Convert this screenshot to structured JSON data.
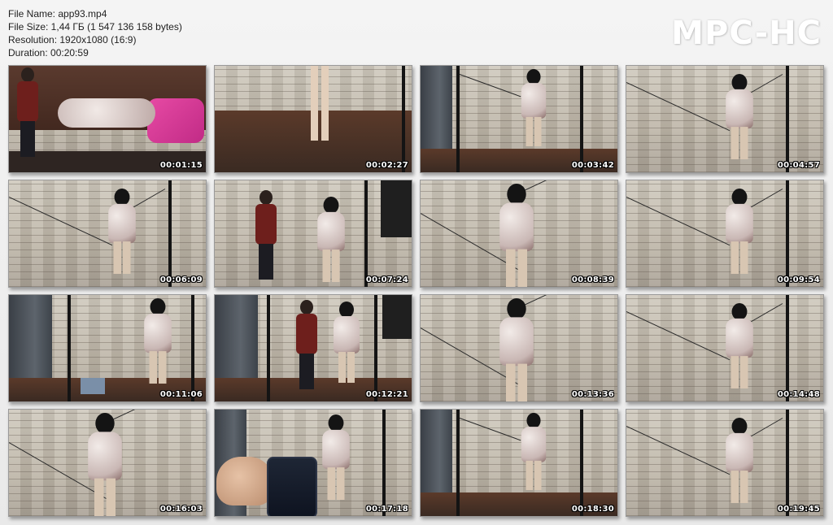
{
  "file_info": {
    "name_line": "File Name: app93.mp4",
    "size_line": "File Size: 1,44 ГБ (1 547 136 158 bytes)",
    "resolution_line": "Resolution: 1920x1080 (16:9)",
    "duration_line": "Duration: 00:20:59"
  },
  "logo": "MPC-HC",
  "thumbnails": [
    {
      "time": "00:01:15",
      "scene": "sofa"
    },
    {
      "time": "00:02:27",
      "scene": "floor-legs"
    },
    {
      "time": "00:03:42",
      "scene": "stage"
    },
    {
      "time": "00:04:57",
      "scene": "wall-figure"
    },
    {
      "time": "00:06:09",
      "scene": "wall-figure"
    },
    {
      "time": "00:07:24",
      "scene": "wall-person-figure"
    },
    {
      "time": "00:08:39",
      "scene": "closeup"
    },
    {
      "time": "00:09:54",
      "scene": "wall-figure"
    },
    {
      "time": "00:11:06",
      "scene": "curtain-figure"
    },
    {
      "time": "00:12:21",
      "scene": "curtain-person-figure"
    },
    {
      "time": "00:13:36",
      "scene": "closeup"
    },
    {
      "time": "00:14:48",
      "scene": "wall-figure"
    },
    {
      "time": "00:16:03",
      "scene": "closeup"
    },
    {
      "time": "00:17:18",
      "scene": "phone"
    },
    {
      "time": "00:18:30",
      "scene": "stage"
    },
    {
      "time": "00:19:45",
      "scene": "wall-figure"
    }
  ]
}
